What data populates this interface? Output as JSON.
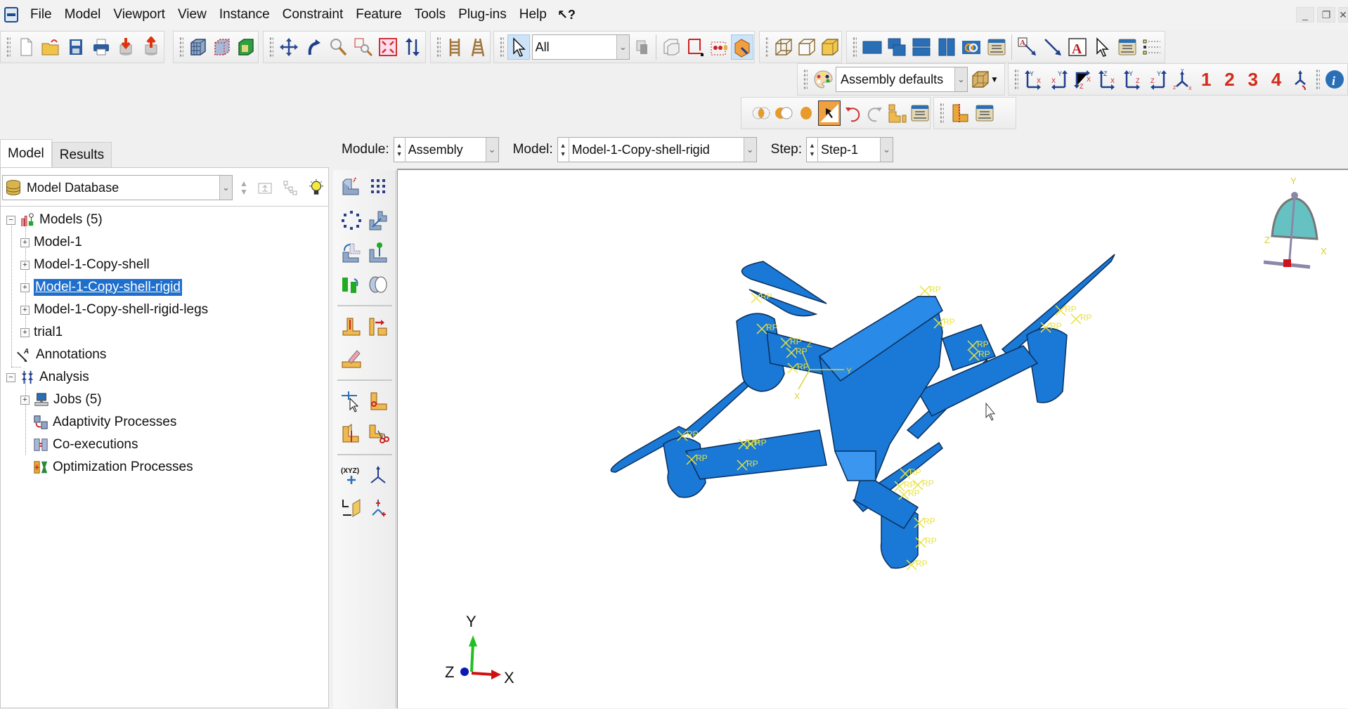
{
  "menubar": {
    "items": [
      {
        "label": "File",
        "mnemonic": "F"
      },
      {
        "label": "Model",
        "mnemonic": "M"
      },
      {
        "label": "Viewport",
        "mnemonic": "w"
      },
      {
        "label": "View",
        "mnemonic": "V"
      },
      {
        "label": "Instance",
        "mnemonic": "I"
      },
      {
        "label": "Constraint",
        "mnemonic": "o"
      },
      {
        "label": "Feature",
        "mnemonic": "u"
      },
      {
        "label": "Tools",
        "mnemonic": "T"
      },
      {
        "label": "Plug-ins",
        "mnemonic": "g"
      },
      {
        "label": "Help",
        "mnemonic": "H"
      }
    ],
    "whats_this": "↖?",
    "window_controls": {
      "minimize": "_",
      "restore": "❐",
      "close": "✕"
    }
  },
  "toolbar": {
    "selection_filter": "All",
    "render_style": "Assembly defaults",
    "view_numbers": [
      "1",
      "2",
      "3",
      "4"
    ],
    "view_axes": [
      {
        "up": "Y",
        "side": "X"
      },
      {
        "up": "Y",
        "side": "X"
      },
      {
        "up": "X",
        "side": "Z"
      },
      {
        "up": "Z",
        "side": "X"
      },
      {
        "up": "Y",
        "side": "Z"
      },
      {
        "up": "Y",
        "side": "Z"
      }
    ]
  },
  "context": {
    "module_label": "Module:",
    "module_value": "Assembly",
    "model_label": "Model:",
    "model_value": "Model-1-Copy-shell-rigid",
    "step_label": "Step:",
    "step_value": "Step-1"
  },
  "tabs": [
    {
      "label": "Model",
      "active": true
    },
    {
      "label": "Results",
      "active": false
    }
  ],
  "tree": {
    "database_label": "Model Database",
    "nodes": [
      {
        "label": "Models (5)",
        "level": 0,
        "expander": "−",
        "icon": "models-icon"
      },
      {
        "label": "Model-1",
        "level": 1,
        "expander": "+"
      },
      {
        "label": "Model-1-Copy-shell",
        "level": 1,
        "expander": "+"
      },
      {
        "label": "Model-1-Copy-shell-rigid",
        "level": 1,
        "expander": "+",
        "selected": true
      },
      {
        "label": "Model-1-Copy-shell-rigid-legs",
        "level": 1,
        "expander": "+"
      },
      {
        "label": "trial1",
        "level": 1,
        "expander": "+"
      },
      {
        "label": "Annotations",
        "level": 0,
        "icon": "annotations-icon"
      },
      {
        "label": "Analysis",
        "level": 0,
        "expander": "−",
        "icon": "analysis-icon"
      },
      {
        "label": "Jobs (5)",
        "level": 1,
        "expander": "+",
        "icon": "jobs-icon"
      },
      {
        "label": "Adaptivity Processes",
        "level": 1,
        "icon": "adaptivity-icon"
      },
      {
        "label": "Co-executions",
        "level": 1,
        "icon": "coexecution-icon"
      },
      {
        "label": "Optimization Processes",
        "level": 1,
        "icon": "optimization-icon"
      }
    ]
  },
  "viewport": {
    "rp_label": "RP",
    "view_triad": {
      "x": "X",
      "y": "Y",
      "z": "Z"
    },
    "global_triad": {
      "x": "X",
      "y": "Y",
      "z": "Z"
    },
    "csys_labels": {
      "x": "X",
      "y": "Y",
      "z": "Z"
    },
    "part_color": "#1a78d6"
  }
}
